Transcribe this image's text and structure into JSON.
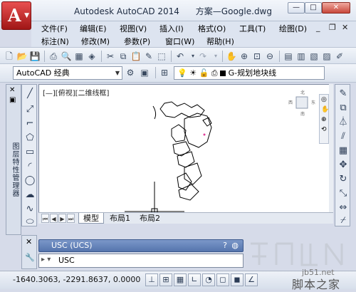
{
  "window": {
    "title": "Autodesk AutoCAD 2014      方案—Google.dwg",
    "app_button_letter": "A"
  },
  "menu": {
    "row1": [
      "文件(F)",
      "编辑(E)",
      "视图(V)",
      "插入(I)",
      "格式(O)",
      "工具(T)",
      "绘图(D)"
    ],
    "row2": [
      "标注(N)",
      "修改(M)",
      "参数(P)",
      "窗口(W)",
      "帮助(H)"
    ]
  },
  "workspace": {
    "label": "AutoCAD 经典"
  },
  "layer": {
    "label": "G-规划地块线",
    "color": "#000000"
  },
  "palette": {
    "label": "图层特性管理器"
  },
  "viewport": {
    "label": "[—][俯视][二维线框]"
  },
  "layout_tabs": [
    "模型",
    "布局1",
    "布局2"
  ],
  "command": {
    "history": "USC (UCS)",
    "input": "USC"
  },
  "status": {
    "coordinates": "-1640.3063, -2291.8637, 0.0000"
  },
  "watermark": {
    "site": "jb51.net",
    "name": "脚本之家"
  },
  "colors": {
    "accent": "#5575ad",
    "app_red": "#c42525",
    "canvas": "#ffffff"
  }
}
